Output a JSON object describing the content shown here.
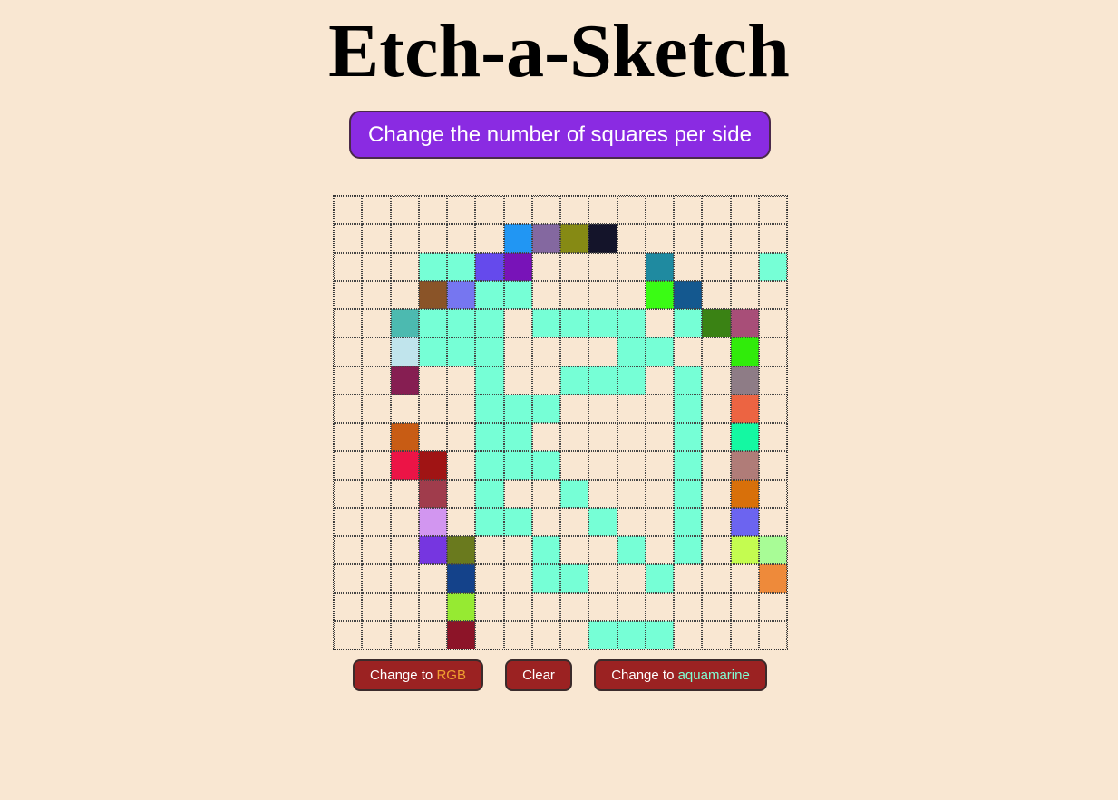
{
  "page": {
    "title": "Etch-a-Sketch",
    "background": "#f9e7d2"
  },
  "controls": {
    "size_button_label": "Change the number of squares per side",
    "size_button_color": "#8a2be2",
    "rgb_button": {
      "prefix": "Change to ",
      "accent": "RGB",
      "accent_color": "#f0a030"
    },
    "clear_button": {
      "label": "Clear"
    },
    "aqua_button": {
      "prefix": "Change to ",
      "accent": "aquamarine",
      "accent_color": "#7fffd4"
    },
    "button_color": "#9b2222"
  },
  "grid": {
    "squares_per_side": 16,
    "cells": [
      [
        "",
        "",
        "",
        "",
        "",
        "",
        "",
        "",
        "",
        "",
        "",
        "",
        "",
        "",
        "",
        ""
      ],
      [
        "",
        "",
        "",
        "",
        "",
        "",
        "#2196f3",
        "#8468a0",
        "#868a14",
        "#14142a",
        "",
        "",
        "",
        "",
        "",
        ""
      ],
      [
        "",
        "",
        "",
        "#76ffd6",
        "#76ffd6",
        "#654aec",
        "#7813b8",
        "",
        "",
        "",
        "",
        "#1f8aa0",
        "",
        "",
        "",
        "#76ffd6"
      ],
      [
        "",
        "",
        "",
        "#8a5428",
        "#7676f0",
        "#76ffd6",
        "#76ffd6",
        "",
        "",
        "",
        "",
        "#3afc14",
        "#14588f",
        "",
        "",
        ""
      ],
      [
        "",
        "",
        "#4cbab0",
        "#76ffd6",
        "#76ffd6",
        "#76ffd6",
        "",
        "#76ffd6",
        "#76ffd6",
        "#76ffd6",
        "#76ffd6",
        "",
        "#76ffd6",
        "#3a8214",
        "#a84e78",
        ""
      ],
      [
        "",
        "",
        "#c0e4ec",
        "#76ffd6",
        "#76ffd6",
        "#76ffd6",
        "",
        "",
        "",
        "",
        "#76ffd6",
        "#76ffd6",
        "",
        "",
        "#30ec0a",
        ""
      ],
      [
        "",
        "",
        "#861e52",
        "",
        "",
        "#76ffd6",
        "",
        "",
        "#76ffd6",
        "#76ffd6",
        "#76ffd6",
        "",
        "#76ffd6",
        "",
        "#8e7c86",
        ""
      ],
      [
        "",
        "",
        "",
        "",
        "",
        "#76ffd6",
        "#76ffd6",
        "#76ffd6",
        "",
        "",
        "",
        "",
        "#76ffd6",
        "",
        "#ec6442",
        ""
      ],
      [
        "",
        "",
        "#c85c14",
        "",
        "",
        "#76ffd6",
        "#76ffd6",
        "",
        "",
        "",
        "",
        "",
        "#76ffd6",
        "",
        "#14f8a2",
        ""
      ],
      [
        "",
        "",
        "#ec1446",
        "#a01414",
        "",
        "#76ffd6",
        "#76ffd6",
        "#76ffd6",
        "",
        "",
        "",
        "",
        "#76ffd6",
        "",
        "#b07c78",
        ""
      ],
      [
        "",
        "",
        "",
        "#a03c4c",
        "",
        "#76ffd6",
        "",
        "",
        "#76ffd6",
        "",
        "",
        "",
        "#76ffd6",
        "",
        "#d8700a",
        ""
      ],
      [
        "",
        "",
        "",
        "#d296f0",
        "",
        "#76ffd6",
        "#76ffd6",
        "",
        "",
        "#76ffd6",
        "",
        "",
        "#76ffd6",
        "",
        "#6c64f0",
        ""
      ],
      [
        "",
        "",
        "",
        "#7636e0",
        "#6a7a1e",
        "",
        "",
        "#76ffd6",
        "",
        "",
        "#76ffd6",
        "",
        "#76ffd6",
        "",
        "#c4fc50",
        "#a8fc96"
      ],
      [
        "",
        "",
        "",
        "",
        "#14428a",
        "",
        "",
        "#76ffd6",
        "#76ffd6",
        "",
        "",
        "#76ffd6",
        "",
        "",
        "",
        "#ee8a3a"
      ],
      [
        "",
        "",
        "",
        "",
        "#96ea32",
        "",
        "",
        "",
        "",
        "",
        "",
        "",
        "",
        "",
        "",
        ""
      ],
      [
        "",
        "",
        "",
        "",
        "#8c1428",
        "",
        "",
        "",
        "",
        "#76ffd6",
        "#76ffd6",
        "#76ffd6",
        "",
        "",
        "",
        ""
      ]
    ]
  }
}
